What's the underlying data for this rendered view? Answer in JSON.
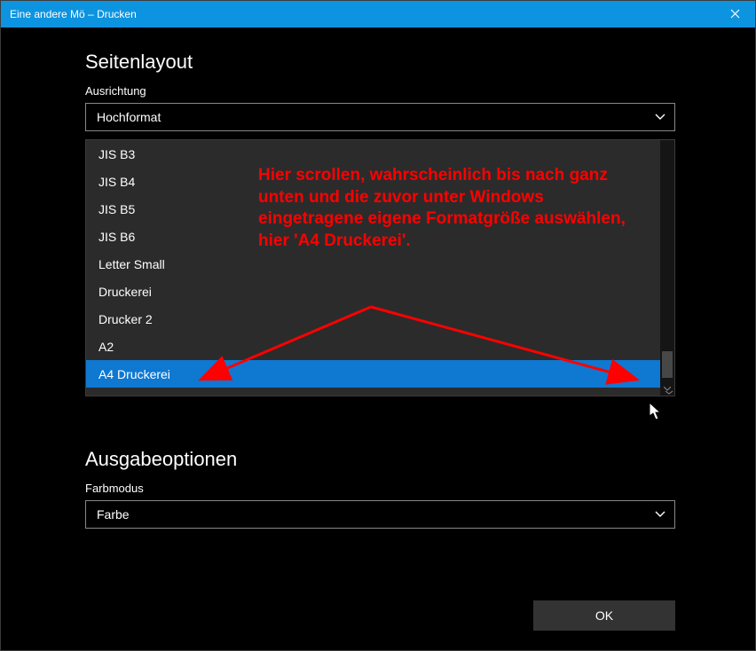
{
  "titlebar": {
    "title": "Eine andere Mö – Drucken"
  },
  "section1": {
    "heading": "Seitenlayout",
    "field1_label": "Ausrichtung",
    "field1_value": "Hochformat"
  },
  "listbox": {
    "items": [
      {
        "label": "JIS B3"
      },
      {
        "label": "JIS B4"
      },
      {
        "label": "JIS B5"
      },
      {
        "label": "JIS B6"
      },
      {
        "label": "Letter Small"
      },
      {
        "label": "Druckerei"
      },
      {
        "label": "Drucker 2"
      },
      {
        "label": "A2"
      },
      {
        "label": "A4 Druckerei"
      }
    ],
    "selected_index": 8
  },
  "annotation": {
    "text": "Hier scrollen, wahrscheinlich bis nach ganz unten und die zuvor unter Windows eingetragene eigene Formatgröße auswählen, hier 'A4 Druckerei'."
  },
  "section2": {
    "heading": "Ausgabeoptionen",
    "field1_label": "Farbmodus",
    "field1_value": "Farbe"
  },
  "buttons": {
    "ok": "OK"
  },
  "colors": {
    "accent": "#0d94e0",
    "select": "#0f78d1",
    "annotation": "#ff0000"
  }
}
